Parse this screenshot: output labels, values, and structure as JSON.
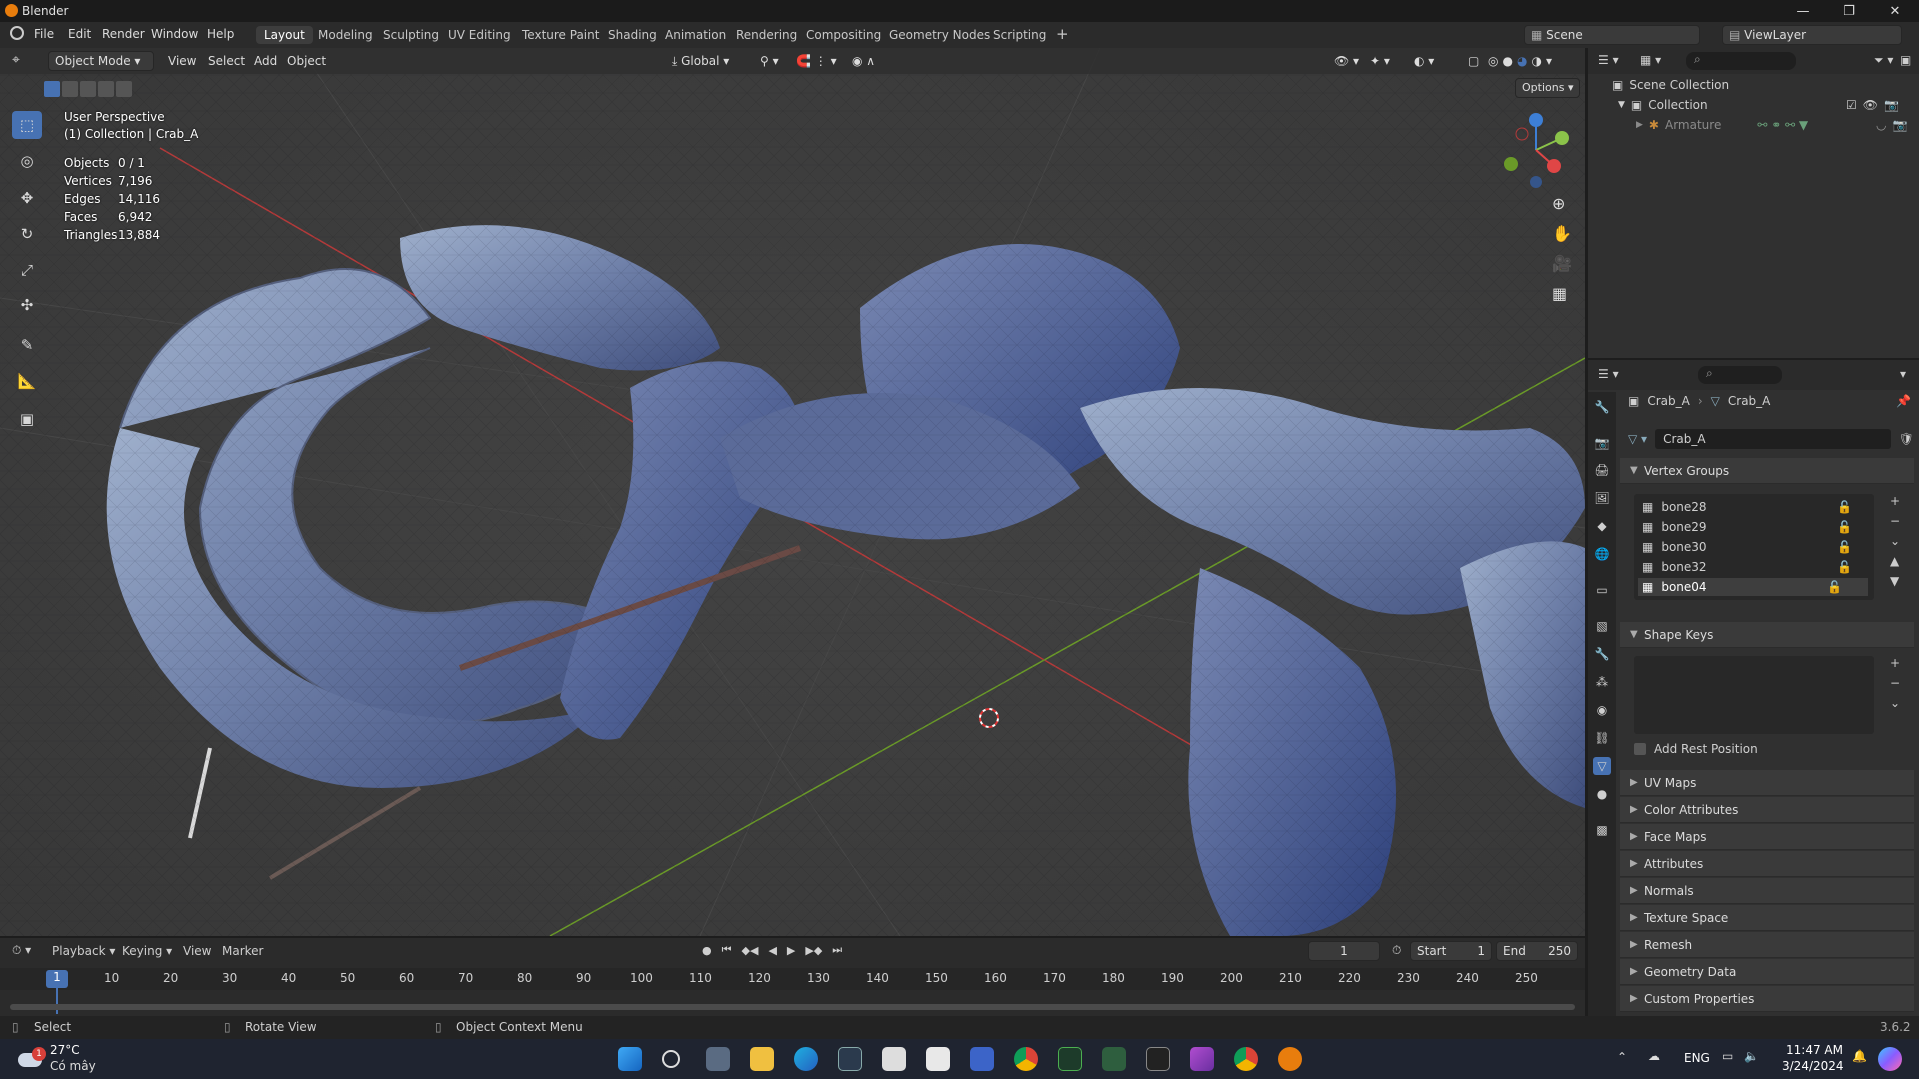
{
  "window": {
    "title": "Blender"
  },
  "menu": [
    "File",
    "Edit",
    "Render",
    "Window",
    "Help"
  ],
  "workspaces": [
    "Layout",
    "Modeling",
    "Sculpting",
    "UV Editing",
    "Texture Paint",
    "Shading",
    "Animation",
    "Rendering",
    "Compositing",
    "Geometry Nodes",
    "Scripting"
  ],
  "scene": {
    "scene_name": "Scene",
    "view_layer": "ViewLayer"
  },
  "viewport_header": {
    "mode": "Object Mode",
    "view": "View",
    "select": "Select",
    "add": "Add",
    "object": "Object",
    "transform": "Global",
    "options": "Options"
  },
  "viewport_overlay": {
    "perspective": "User Perspective",
    "collection": "(1) Collection | Crab_A",
    "stats": [
      {
        "label": "Objects",
        "value": "0 / 1"
      },
      {
        "label": "Vertices",
        "value": "7,196"
      },
      {
        "label": "Edges",
        "value": "14,116"
      },
      {
        "label": "Faces",
        "value": "6,942"
      },
      {
        "label": "Triangles",
        "value": "13,884"
      }
    ]
  },
  "outliner": {
    "scene_collection": "Scene Collection",
    "collection": "Collection",
    "armature": "Armature"
  },
  "properties": {
    "breadcrumb_object": "Crab_A",
    "breadcrumb_data": "Crab_A",
    "data_name": "Crab_A",
    "vertex_groups_title": "Vertex Groups",
    "vertex_groups": [
      "bone28",
      "bone29",
      "bone30",
      "bone32",
      "bone04"
    ],
    "shape_keys_title": "Shape Keys",
    "add_rest_position": "Add Rest Position",
    "sections": [
      "UV Maps",
      "Color Attributes",
      "Face Maps",
      "Attributes",
      "Normals",
      "Texture Space",
      "Remesh",
      "Geometry Data",
      "Custom Properties"
    ]
  },
  "timeline": {
    "playback": "Playback",
    "keying": "Keying",
    "view": "View",
    "marker": "Marker",
    "current_frame": "1",
    "start_label": "Start",
    "start": "1",
    "end_label": "End",
    "end": "250",
    "ticks": [
      "1",
      "10",
      "20",
      "30",
      "40",
      "50",
      "60",
      "70",
      "80",
      "90",
      "100",
      "110",
      "120",
      "130",
      "140",
      "150",
      "160",
      "170",
      "180",
      "190",
      "200",
      "210",
      "220",
      "230",
      "240",
      "250"
    ]
  },
  "statusbar": {
    "select": "Select",
    "rotate": "Rotate View",
    "context": "Object Context Menu",
    "version": "3.6.2"
  },
  "taskbar": {
    "temp": "27°C",
    "weather": "Có mây",
    "lang": "ENG",
    "time": "11:47 AM",
    "date": "3/24/2024"
  },
  "colors": {
    "accent": "#4772b3",
    "active_tab": "#3d3d3d",
    "orange": "#e87d0d"
  }
}
